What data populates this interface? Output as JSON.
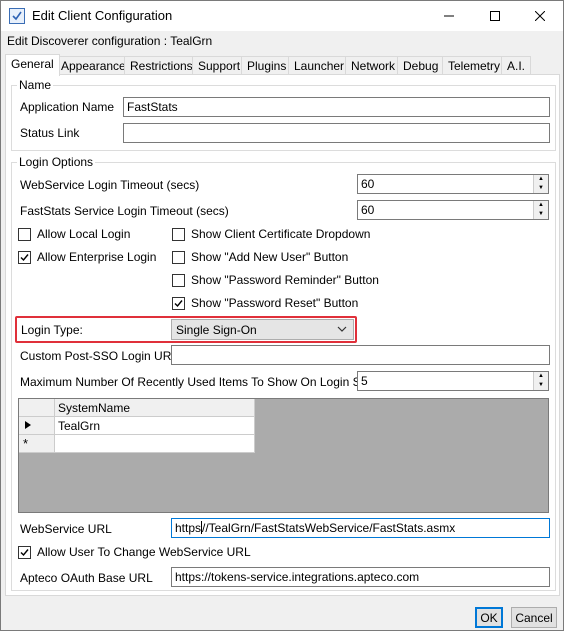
{
  "window": {
    "title": "Edit Client Configuration",
    "subtitle": "Edit Discoverer configuration : TealGrn"
  },
  "tabs": [
    {
      "label": "General",
      "active": true
    },
    {
      "label": "Appearance"
    },
    {
      "label": "Restrictions"
    },
    {
      "label": "Support"
    },
    {
      "label": "Plugins"
    },
    {
      "label": "Launcher"
    },
    {
      "label": "Network"
    },
    {
      "label": "Debug"
    },
    {
      "label": "Telemetry"
    },
    {
      "label": "A.I."
    }
  ],
  "name_group": {
    "title": "Name",
    "application_name_label": "Application Name",
    "application_name_value": "FastStats",
    "status_link_label": "Status Link",
    "status_link_value": ""
  },
  "login_group": {
    "title": "Login Options",
    "ws_timeout_label": "WebService Login Timeout (secs)",
    "ws_timeout_value": "60",
    "fs_timeout_label": "FastStats Service Login Timeout (secs)",
    "fs_timeout_value": "60",
    "allow_local_login": {
      "label": "Allow Local Login",
      "checked": false
    },
    "allow_enterprise_login": {
      "label": "Allow Enterprise Login",
      "checked": true
    },
    "show_cert_dropdown": {
      "label": "Show Client Certificate Dropdown",
      "checked": false
    },
    "show_add_new_user": {
      "label": "Show \"Add New User\" Button",
      "checked": false
    },
    "show_password_reminder": {
      "label": "Show \"Password Reminder\" Button",
      "checked": false
    },
    "show_password_reset": {
      "label": "Show \"Password Reset\" Button",
      "checked": true
    },
    "login_type_label": "Login Type:",
    "login_type_value": "Single Sign-On",
    "custom_sso_label": "Custom Post-SSO Login URL:",
    "custom_sso_value": "",
    "max_recent_label": "Maximum Number Of Recently Used Items To Show On Login Screen",
    "max_recent_value": "5"
  },
  "grid": {
    "column_header": "SystemName",
    "rows": [
      "TealGrn"
    ],
    "new_row_marker": "*"
  },
  "webservice_url_label": "WebService URL",
  "webservice_url_before_caret": "https",
  "webservice_url_after_caret": "//TealGrn/FastStatsWebService/FastStats.asmx",
  "allow_change_ws": {
    "label": "Allow User To Change WebService URL",
    "checked": true
  },
  "oauth_label": "Apteco OAuth Base URL",
  "oauth_value": "https://tokens-service.integrations.apteco.com",
  "footer": {
    "ok_label": "OK",
    "cancel_label": "Cancel"
  },
  "colors": {
    "highlight": "#e0303a",
    "accent": "#0078d7"
  }
}
